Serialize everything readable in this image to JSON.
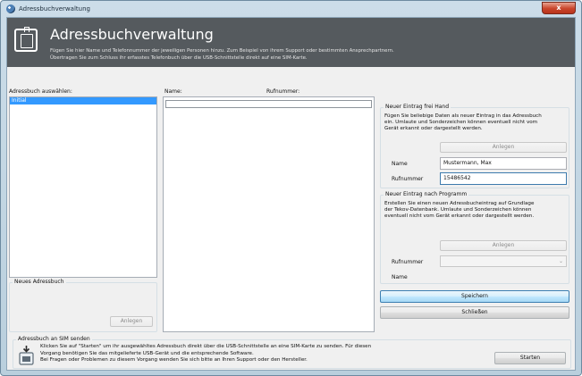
{
  "window": {
    "title": "Adressbuchverwaltung",
    "close_glyph": "x"
  },
  "banner": {
    "title": "Adressbuchverwaltung",
    "desc_line1": "Fügen Sie hier Name und Telefonnummer der jeweiligen Personen hinzu. Zum Beispiel von ihrem Support oder bestimmten Ansprechpartnern.",
    "desc_line2": "Übertragen Sie zum Schluss ihr erfasstes Telefonbuch über die USB-Schnittstelle direkt auf eine SIM-Karte."
  },
  "addressbook": {
    "label": "Adressbuch auswählen:",
    "items": [
      "Initial"
    ]
  },
  "entries": {
    "name_header": "Name:",
    "number_header": "Rufnummer:"
  },
  "new_book": {
    "title": "Neues Adressbuch",
    "button": "Anlegen"
  },
  "manual_entry": {
    "title": "Neuer Eintrag frei Hand",
    "line1": "Fügen Sie beliebige Daten als neuer Eintrag in das Adressbuch",
    "line2": "ein. Umlaute und Sonderzeichen können eventuell nicht vom",
    "line3": "Gerät erkannt oder dargestellt werden.",
    "button": "Anlegen",
    "name_label": "Name",
    "name_value": "Mustermann, Max",
    "number_label": "Rufnummer",
    "number_value": "15486542"
  },
  "program_entry": {
    "title": "Neuer Eintrag nach Programm",
    "line1": "Erstellen Sie einen neuen Adressbucheintrag auf Grundlage",
    "line2": "der Tekov-Datenbank. Umlaute und Sonderzeichen können",
    "line3": "eventuell nicht vom Gerät erkannt oder dargestellt werden.",
    "button": "Anlegen",
    "number_label": "Rufnummer",
    "name_label": "Name"
  },
  "actions": {
    "save": "Speichern",
    "close": "Schließen"
  },
  "sim": {
    "title": "Adressbuch an SIM senden",
    "line1": "Klicken Sie auf \"Starten\" um ihr ausgewähltes Adressbuch direkt über die USB-Schnittstelle an eine SIM-Karte zu senden. Für diesen",
    "line2": "Vorgang benötigen Sie das mitgelieferte USB-Gerät und die entsprechende Software.",
    "line3": "Bei Fragen oder Problemen zu diesem Vorgang wenden Sie sich bitte an Ihren Support oder den Hersteller.",
    "button": "Starten"
  },
  "colors": {
    "banner_bg": "#555a5e",
    "selection": "#3399ff",
    "primary_button": "#bee6fd"
  }
}
